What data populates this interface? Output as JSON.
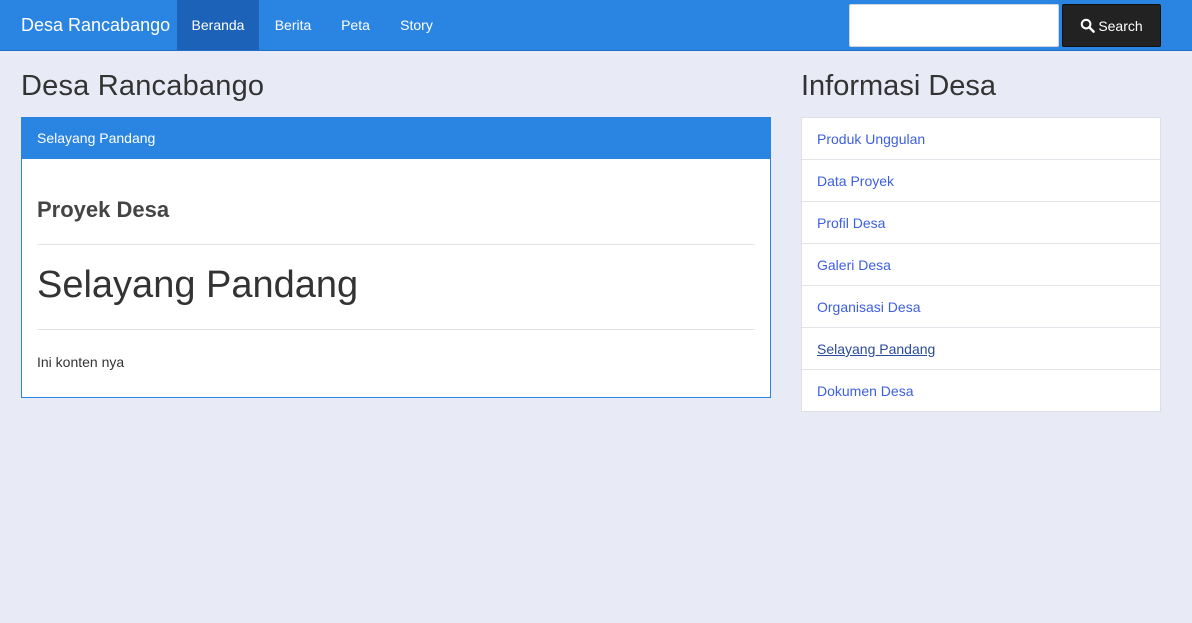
{
  "navbar": {
    "brand": "Desa Rancabango",
    "items": [
      {
        "label": "Beranda",
        "active": true
      },
      {
        "label": "Berita",
        "active": false
      },
      {
        "label": "Peta",
        "active": false
      },
      {
        "label": "Story",
        "active": false
      }
    ],
    "search_value": "",
    "search_button": "Search",
    "search_icon": "search-icon"
  },
  "main": {
    "title": "Desa Rancabango",
    "panel_heading": "Selayang Pandang",
    "proyek_title": "Proyek Desa",
    "content_title": "Selayang Pandang",
    "content_body": "Ini konten nya"
  },
  "sidebar": {
    "title": "Informasi Desa",
    "items": [
      {
        "label": "Produk Unggulan"
      },
      {
        "label": "Data Proyek"
      },
      {
        "label": "Profil Desa"
      },
      {
        "label": "Galeri Desa"
      },
      {
        "label": "Organisasi Desa"
      },
      {
        "label": "Selayang Pandang"
      },
      {
        "label": "Dokumen Desa"
      }
    ]
  },
  "colors": {
    "accent": "#2a84e2",
    "nav_active": "#1b62b8",
    "background": "#e8eaf5",
    "link": "#3d5fe0"
  }
}
